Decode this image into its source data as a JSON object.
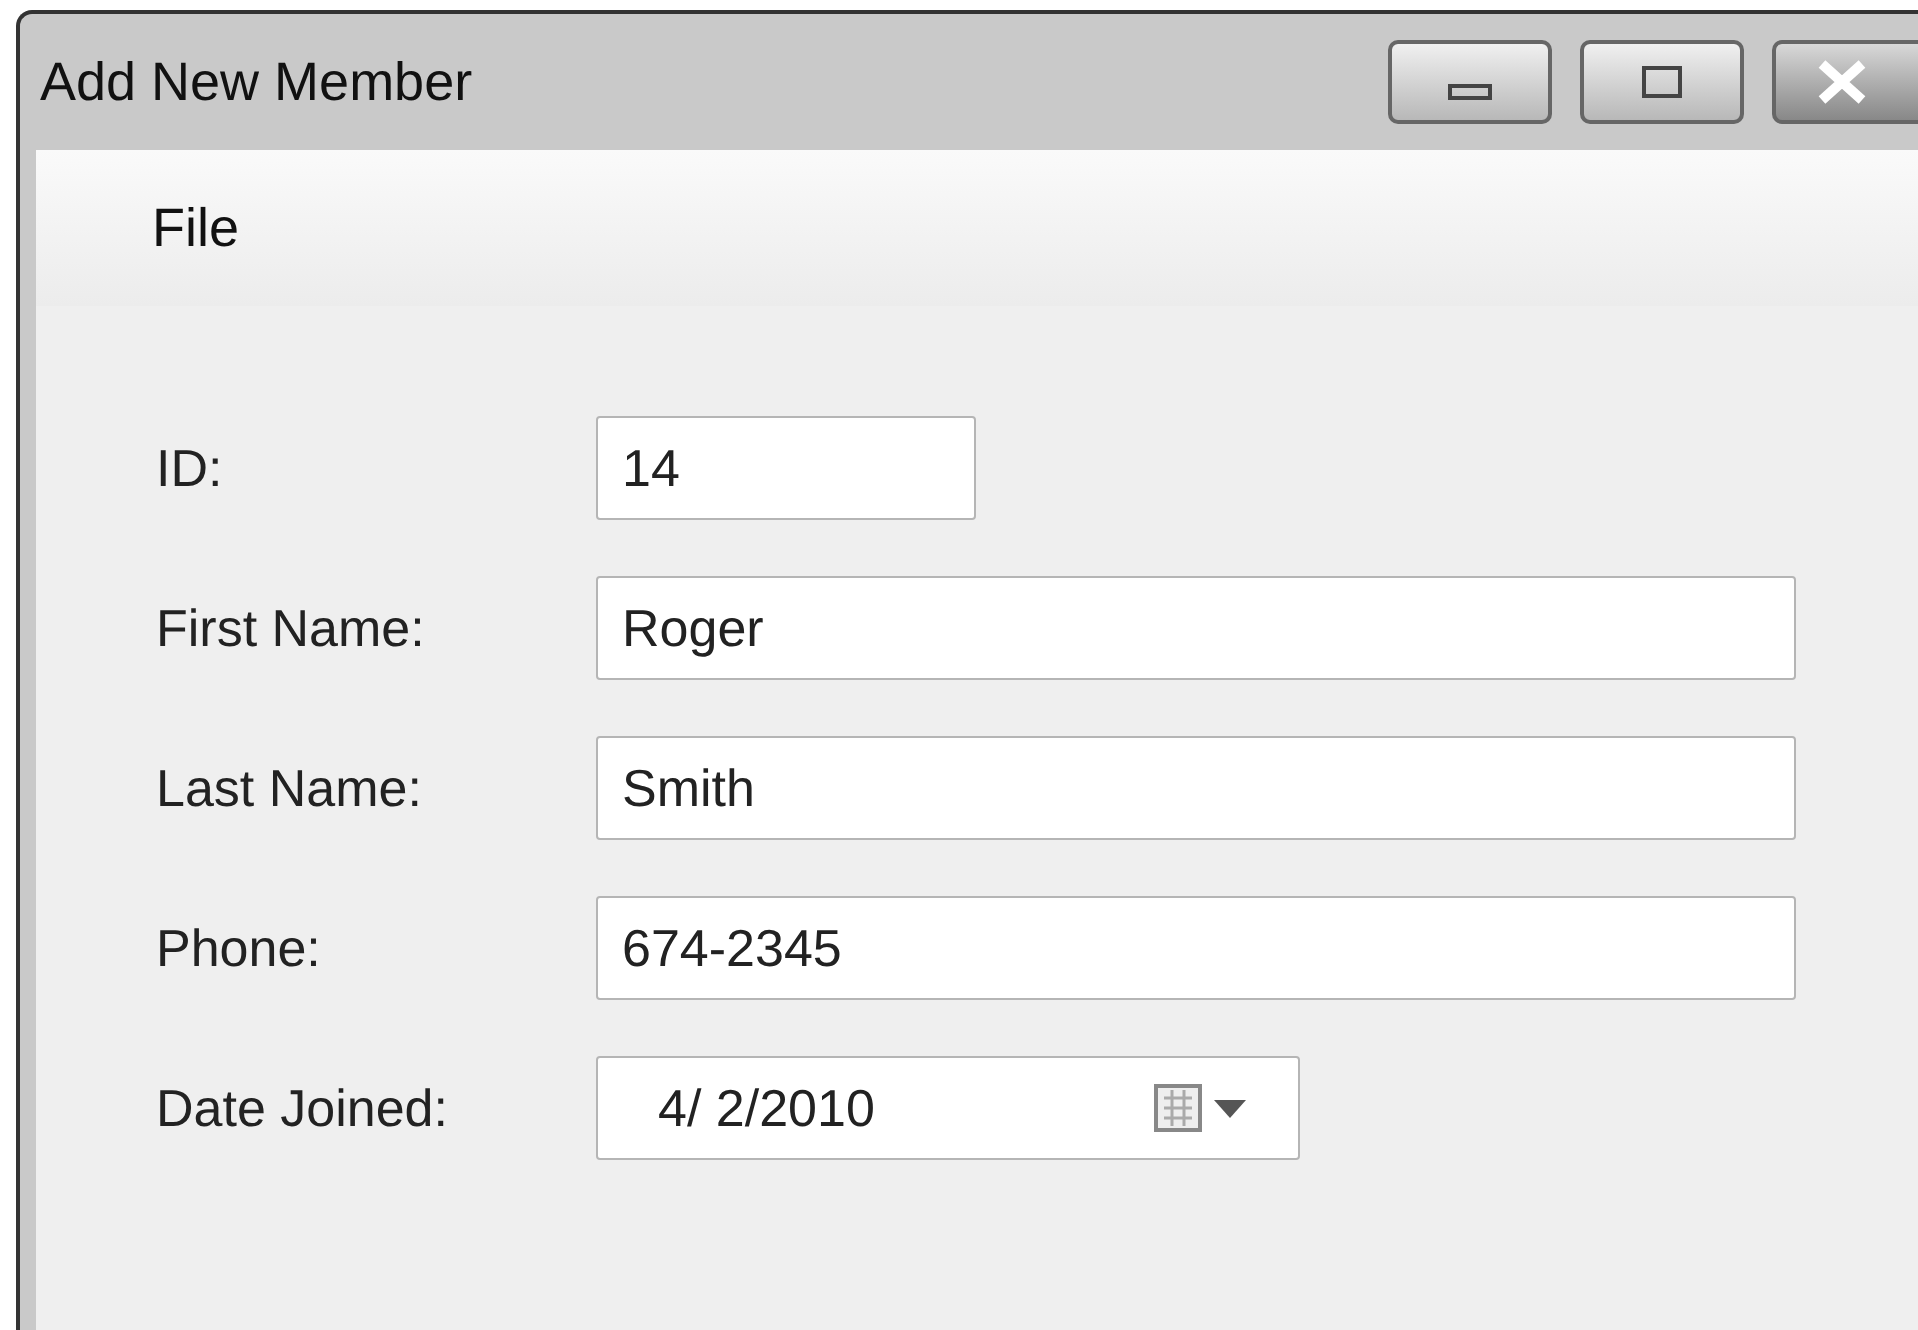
{
  "window": {
    "title": "Add New Member"
  },
  "menu": [
    {
      "label": "File"
    }
  ],
  "fields": [
    {
      "label": "ID:",
      "value": "14",
      "kind": "short"
    },
    {
      "label": "First Name:",
      "value": "Roger",
      "kind": "text"
    },
    {
      "label": "Last Name:",
      "value": "Smith",
      "kind": "text"
    },
    {
      "label": "Phone:",
      "value": "674-2345",
      "kind": "text"
    },
    {
      "label": "Date Joined:",
      "value": "4/ 2/2010",
      "kind": "date"
    }
  ]
}
